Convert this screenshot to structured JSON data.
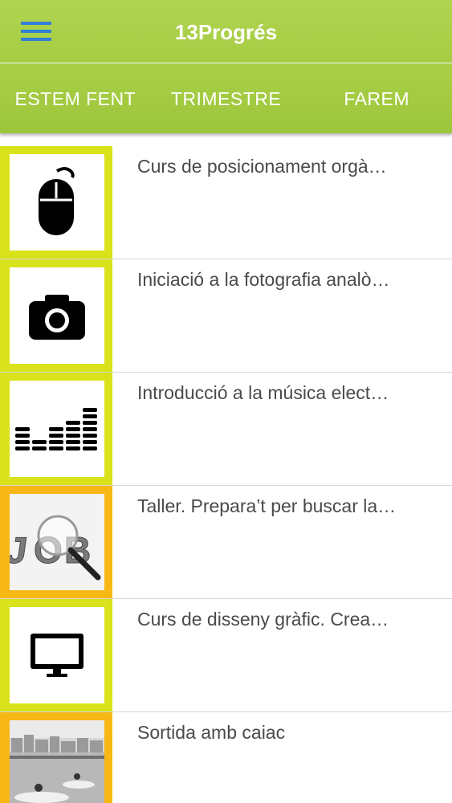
{
  "app": {
    "title": "13Progrés"
  },
  "tabs": [
    {
      "label": "ESTEM FENT"
    },
    {
      "label": "TRIMESTRE"
    },
    {
      "label": "FAREM"
    }
  ],
  "items": [
    {
      "title": "Curs de posicionament orgà…",
      "icon": "mouse-icon"
    },
    {
      "title": "Iniciació a la fotografia analò…",
      "icon": "camera-icon"
    },
    {
      "title": "Introducció a la música elect…",
      "icon": "equalizer-icon"
    },
    {
      "title": "Taller. Prepara’t per buscar la…",
      "icon": "job-search-image"
    },
    {
      "title": "Curs de disseny gràfic. Crea…",
      "icon": "monitor-icon"
    },
    {
      "title": "Sortida amb caiac",
      "icon": "kayak-photo"
    }
  ],
  "colors": {
    "header": "#a8cd47",
    "menu_icon": "#2f7fd8",
    "thumb_border_yellow": "#d9e21a",
    "thumb_border_orange": "#f7b816"
  }
}
